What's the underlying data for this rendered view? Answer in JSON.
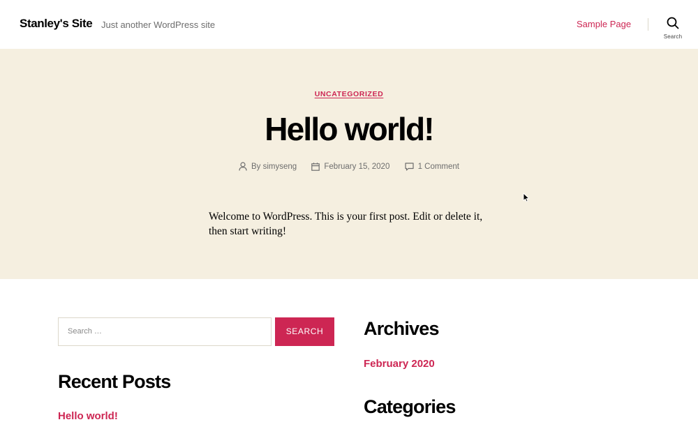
{
  "header": {
    "site_title": "Stanley's Site",
    "site_description": "Just another WordPress site",
    "nav_items": [
      "Sample Page"
    ],
    "search_label": "Search"
  },
  "post": {
    "category": "UNCATEGORIZED",
    "title": "Hello world!",
    "author": "By simyseng",
    "date": "February 15, 2020",
    "comments": "1 Comment",
    "content": "Welcome to WordPress. This is your first post. Edit or delete it, then start writing!"
  },
  "widgets": {
    "search": {
      "placeholder": "Search …",
      "button_label": "SEARCH"
    },
    "recent_posts": {
      "title": "Recent Posts",
      "items": [
        "Hello world!"
      ]
    },
    "archives": {
      "title": "Archives",
      "items": [
        "February 2020"
      ]
    },
    "categories": {
      "title": "Categories"
    }
  },
  "colors": {
    "accent": "#cd2653",
    "hero_background": "#f5efe0",
    "secondary_text": "#6d6d6d"
  },
  "icons": {
    "search": "search-icon",
    "author": "user-icon",
    "date": "calendar-icon",
    "comments": "comment-icon",
    "cursor": "mouse-cursor-icon"
  }
}
